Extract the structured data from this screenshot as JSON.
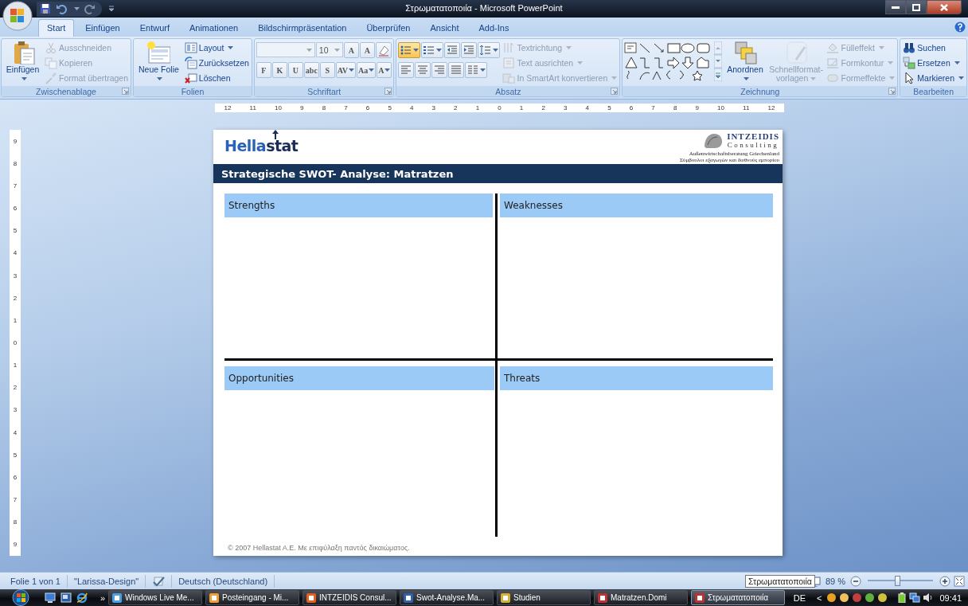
{
  "window": {
    "title": "Στρωματατοποιία - Microsoft PowerPoint"
  },
  "tabs": [
    {
      "label": "Start",
      "selected": true
    },
    {
      "label": "Einfügen",
      "selected": false
    },
    {
      "label": "Entwurf",
      "selected": false
    },
    {
      "label": "Animationen",
      "selected": false
    },
    {
      "label": "Bildschirmpräsentation",
      "selected": false
    },
    {
      "label": "Überprüfen",
      "selected": false
    },
    {
      "label": "Ansicht",
      "selected": false
    },
    {
      "label": "Add-Ins",
      "selected": false
    }
  ],
  "ribbon": {
    "groups": [
      {
        "label": "Zwischenablage",
        "launcher": true,
        "columns": [
          {
            "kind": "large",
            "items": [
              {
                "label": "Einfügen",
                "dropdown": true,
                "disabled": false
              }
            ]
          },
          {
            "kind": "stack",
            "items": [
              {
                "label": "Ausschneiden",
                "dropdown": false,
                "disabled": true
              },
              {
                "label": "Kopieren",
                "dropdown": false,
                "disabled": true
              },
              {
                "label": "Format übertragen",
                "dropdown": false,
                "disabled": true
              }
            ]
          }
        ]
      },
      {
        "label": "Folien",
        "launcher": false,
        "columns": [
          {
            "kind": "large",
            "items": [
              {
                "label": "Neue Folie",
                "dropdown": true,
                "disabled": false
              }
            ]
          },
          {
            "kind": "stack",
            "items": [
              {
                "label": "Layout",
                "dropdown": true,
                "disabled": false
              },
              {
                "label": "Zurücksetzen",
                "dropdown": false,
                "disabled": false
              },
              {
                "label": "Löschen",
                "dropdown": false,
                "disabled": false
              }
            ]
          }
        ]
      },
      {
        "label": "Schriftart",
        "launcher": true,
        "columns": [
          {
            "kind": "bars",
            "button_rows": [
              {
                "buttons": [
                  {
                    "kind": "font_box"
                  },
                  {
                    "kind": "size_box",
                    "value": "10"
                  },
                  {
                    "kind": "button",
                    "text": "A",
                    "dropdown": false,
                    "selected": false
                  },
                  {
                    "kind": "button",
                    "text": "A",
                    "dropdown": false,
                    "selected": false
                  },
                  {
                    "kind": "button",
                    "dropdown": false,
                    "selected": false
                  }
                ]
              },
              {
                "buttons": [
                  {
                    "kind": "button",
                    "text": "F",
                    "dropdown": false,
                    "selected": false
                  },
                  {
                    "kind": "button",
                    "text": "K",
                    "dropdown": false,
                    "selected": false
                  },
                  {
                    "kind": "button",
                    "text": "U",
                    "dropdown": false,
                    "selected": false
                  },
                  {
                    "kind": "button",
                    "text": "abc",
                    "dropdown": false,
                    "selected": false
                  },
                  {
                    "kind": "button",
                    "text": "S",
                    "dropdown": false,
                    "selected": false
                  },
                  {
                    "kind": "button",
                    "text": "AV",
                    "dropdown": true,
                    "selected": false
                  },
                  {
                    "kind": "button",
                    "text": "Aa",
                    "dropdown": true,
                    "selected": false
                  },
                  {
                    "kind": "button",
                    "text": "A",
                    "dropdown": true,
                    "selected": false
                  }
                ]
              }
            ]
          }
        ]
      },
      {
        "label": "Absatz",
        "launcher": true,
        "columns": [
          {
            "kind": "bars",
            "button_rows": [
              {
                "buttons": [
                  {
                    "kind": "button",
                    "dropdown": true,
                    "selected": true
                  },
                  {
                    "kind": "button",
                    "dropdown": true,
                    "selected": false
                  },
                  {
                    "kind": "button",
                    "dropdown": false,
                    "selected": false
                  },
                  {
                    "kind": "button",
                    "dropdown": false,
                    "selected": false
                  },
                  {
                    "kind": "button",
                    "dropdown": true,
                    "selected": false
                  }
                ]
              },
              {
                "buttons": [
                  {
                    "kind": "button",
                    "dropdown": false,
                    "selected": false
                  },
                  {
                    "kind": "button",
                    "dropdown": false,
                    "selected": false
                  },
                  {
                    "kind": "button",
                    "dropdown": false,
                    "selected": false
                  },
                  {
                    "kind": "button",
                    "dropdown": false,
                    "selected": false
                  },
                  {
                    "kind": "button",
                    "dropdown": true,
                    "selected": false
                  }
                ]
              }
            ]
          },
          {
            "kind": "stack",
            "items": [
              {
                "label": "Textrichtung",
                "dropdown": true,
                "disabled": true
              },
              {
                "label": "Text ausrichten",
                "dropdown": true,
                "disabled": true
              },
              {
                "label": "In SmartArt konvertieren",
                "dropdown": true,
                "disabled": true
              }
            ]
          }
        ]
      },
      {
        "label": "Zeichnung",
        "launcher": true,
        "columns": [
          {
            "kind": "gallery"
          },
          {
            "kind": "large",
            "items": [
              {
                "label": "Anordnen",
                "dropdown": true,
                "disabled": false
              }
            ]
          },
          {
            "kind": "large",
            "items": [
              {
                "label": "Schnellformat-vorlagen",
                "dropdown": true,
                "disabled": true
              }
            ]
          },
          {
            "kind": "stack",
            "items": [
              {
                "label": "Fülleffekt",
                "dropdown": true,
                "disabled": true
              },
              {
                "label": "Formkontur",
                "dropdown": true,
                "disabled": true
              },
              {
                "label": "Formeffekte",
                "dropdown": true,
                "disabled": true
              }
            ]
          }
        ]
      },
      {
        "label": "Bearbeiten",
        "launcher": false,
        "columns": [
          {
            "kind": "stack",
            "items": [
              {
                "label": "Suchen",
                "dropdown": false,
                "disabled": false
              },
              {
                "label": "Ersetzen",
                "dropdown": true,
                "disabled": false
              },
              {
                "label": "Markieren",
                "dropdown": true,
                "disabled": false
              }
            ]
          }
        ]
      }
    ]
  },
  "rulers": {
    "horizontal": [
      "12",
      "11",
      "10",
      "9",
      "8",
      "7",
      "6",
      "5",
      "4",
      "3",
      "2",
      "1",
      "0",
      "1",
      "2",
      "3",
      "4",
      "5",
      "6",
      "7",
      "8",
      "9",
      "10",
      "11",
      "12"
    ],
    "vertical": [
      "9",
      "8",
      "7",
      "6",
      "5",
      "4",
      "3",
      "2",
      "1",
      "0",
      "1",
      "2",
      "3",
      "4",
      "5",
      "6",
      "7",
      "8",
      "9"
    ]
  },
  "slide": {
    "brand": {
      "part_1": "Hella",
      "part_2": "stat"
    },
    "partner": {
      "name": "INTZEIDIS",
      "subtitle": "Consulting",
      "tagline_1": "Außenwirtschaftsberatung Griechenland",
      "tagline_2": "Σύμβουλοι εξαγωγών και διεθνούς εμπορίου"
    },
    "title": "Strategische SWOT- Analyse: Matratzen",
    "quadrants": [
      {
        "heading": "Strengths"
      },
      {
        "heading": "Weaknesses"
      },
      {
        "heading": "Opportunities"
      },
      {
        "heading": "Threats"
      }
    ],
    "footer": "© 2007 Hellastat A.E. Με επιφύλαξη παντός δικαιώματος."
  },
  "status_bar": {
    "slide_count": "Folie 1 von 1",
    "theme": "\"Larissa-Design\"",
    "language": "Deutsch (Deutschland)",
    "zoom": "89 %",
    "zoom_slider": {
      "level": 0.45
    },
    "tooltip": "Στρωματατοποιία"
  },
  "taskbar": {
    "more": "»",
    "buttons": [
      {
        "label": "Windows Live Me...",
        "selected": false
      },
      {
        "label": "Posteingang - Mi...",
        "selected": false
      },
      {
        "label": "INTZEIDIS Consul...",
        "selected": false
      },
      {
        "label": "Swot-Analyse.Ma...",
        "selected": false
      },
      {
        "label": "Studien",
        "selected": false
      },
      {
        "label": "Matratzen.Domi",
        "selected": false
      },
      {
        "label": "Στρωματατοποιία",
        "selected": true
      }
    ],
    "tray": {
      "language": "DE",
      "expand": "<",
      "time": "09:41"
    }
  }
}
